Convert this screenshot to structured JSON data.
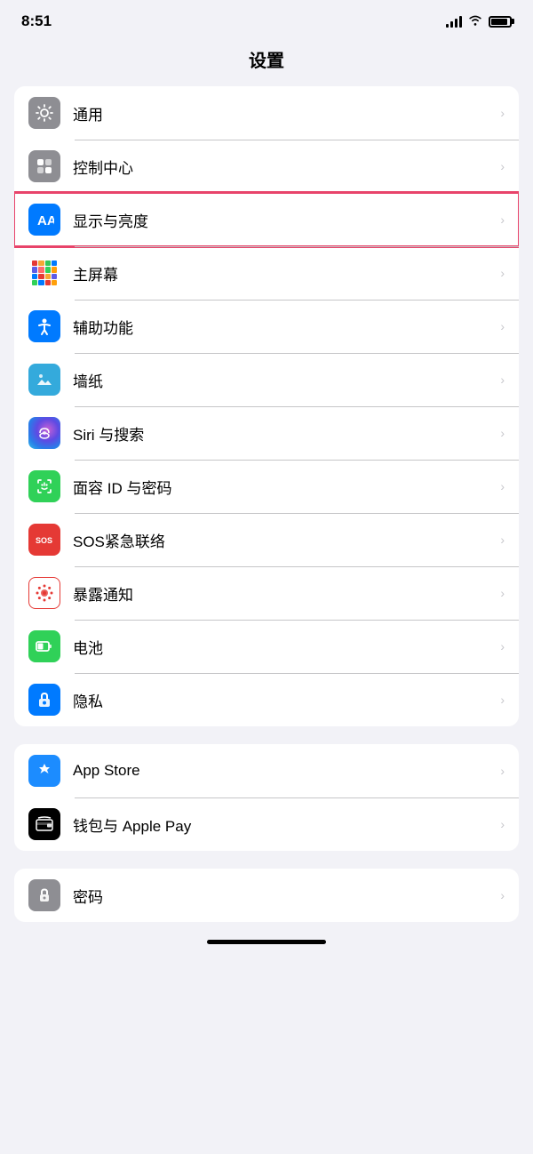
{
  "statusBar": {
    "time": "8:51"
  },
  "pageTitle": "设置",
  "group1": {
    "items": [
      {
        "id": "general",
        "label": "通用",
        "iconType": "gray",
        "highlighted": false
      },
      {
        "id": "control-center",
        "label": "控制中心",
        "iconType": "gray2",
        "highlighted": false
      },
      {
        "id": "display",
        "label": "显示与亮度",
        "iconType": "blue",
        "highlighted": true
      },
      {
        "id": "home-screen",
        "label": "主屏幕",
        "iconType": "colorful",
        "highlighted": false
      },
      {
        "id": "accessibility",
        "label": "辅助功能",
        "iconType": "blue2",
        "highlighted": false
      },
      {
        "id": "wallpaper",
        "label": "墙纸",
        "iconType": "blue3",
        "highlighted": false
      },
      {
        "id": "siri",
        "label": "Siri 与搜索",
        "iconType": "siri",
        "highlighted": false
      },
      {
        "id": "faceid",
        "label": "面容 ID 与密码",
        "iconType": "green-face",
        "highlighted": false
      },
      {
        "id": "sos",
        "label": "SOS紧急联络",
        "iconType": "red-sos",
        "highlighted": false
      },
      {
        "id": "exposure",
        "label": "暴露通知",
        "iconType": "exposure",
        "highlighted": false
      },
      {
        "id": "battery",
        "label": "电池",
        "iconType": "battery",
        "highlighted": false
      },
      {
        "id": "privacy",
        "label": "隐私",
        "iconType": "privacy",
        "highlighted": false
      }
    ]
  },
  "group2": {
    "items": [
      {
        "id": "appstore",
        "label": "App Store",
        "iconType": "appstore",
        "highlighted": false
      },
      {
        "id": "wallet",
        "label": "钱包与 Apple Pay",
        "iconType": "wallet",
        "highlighted": false
      }
    ]
  },
  "group3": {
    "items": [
      {
        "id": "password",
        "label": "密码",
        "iconType": "password",
        "highlighted": false
      }
    ]
  },
  "chevron": "›"
}
